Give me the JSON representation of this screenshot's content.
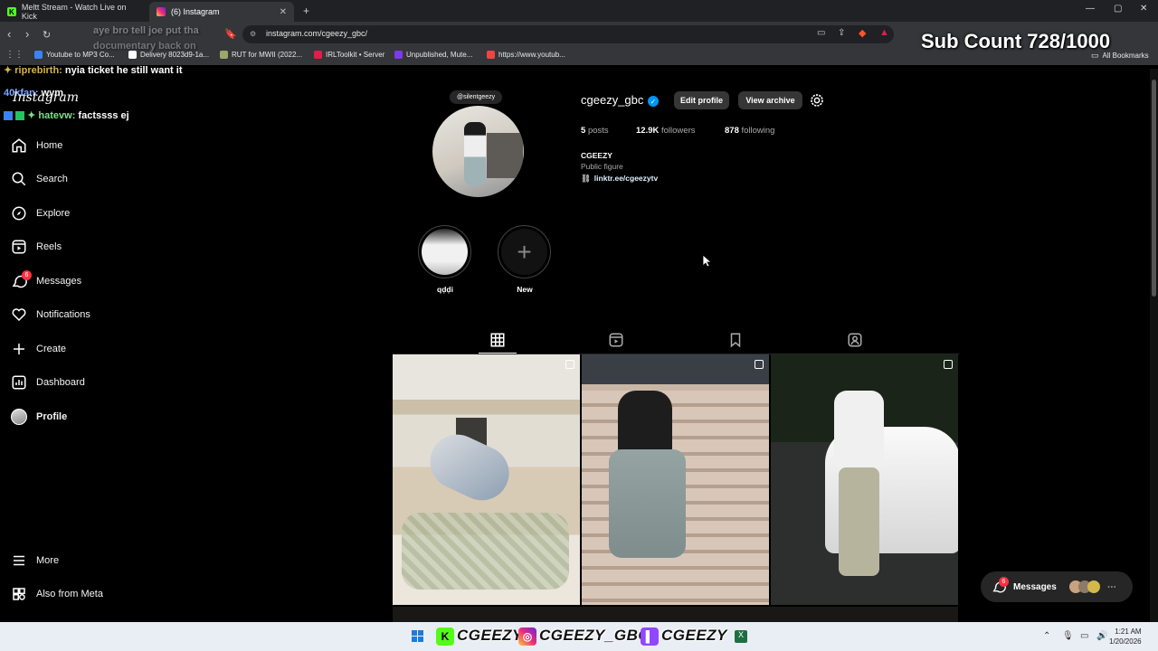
{
  "tabs": [
    {
      "title": "Meltt Stream - Watch Live on Kick",
      "icon": "kick-icon"
    },
    {
      "title": "(6) Instagram",
      "icon": "instagram-icon"
    }
  ],
  "address": {
    "url": "instagram.com/cgeezy_gbc/"
  },
  "bookmarks": [
    {
      "label": "Youtube to MP3 Co...",
      "color": "#3b82f6"
    },
    {
      "label": "Delivery 8023d9-1a...",
      "color": "#ffffff"
    },
    {
      "label": "RUT for MWII (2022...",
      "color": "#9aa86b"
    },
    {
      "label": "IRLToolkit • Server",
      "color": "#e11d48"
    },
    {
      "label": "Unpublished, Mute...",
      "color": "#7c3aed"
    },
    {
      "label": "https://www.youtub...",
      "color": "#ef4444"
    }
  ],
  "bookmarks_all": "All Bookmarks",
  "overlay": {
    "sub_count": "Sub Count 728/1000",
    "chat": [
      {
        "user": "aye bro tell joe put tha",
        "msg": "",
        "color": "#bbbbbb"
      },
      {
        "user": "documentary back on",
        "msg": "",
        "color": "#bbbbbb"
      },
      {
        "user": "✦ riprebirth:",
        "msg": "nyia ticket he still want it",
        "color": "#d4b34a"
      },
      {
        "user": "40kfan:",
        "msg": "wym",
        "color": "#7aa7ff"
      },
      {
        "user": "✦ hatevw:",
        "msg": "factssss ej",
        "color": "#7ee08a"
      }
    ]
  },
  "sidebar": {
    "logo": "Instagram",
    "items": [
      {
        "label": "Home",
        "icon": "home-icon"
      },
      {
        "label": "Search",
        "icon": "search-icon"
      },
      {
        "label": "Explore",
        "icon": "compass-icon"
      },
      {
        "label": "Reels",
        "icon": "reels-icon"
      },
      {
        "label": "Messages",
        "icon": "messenger-icon",
        "badge": "6"
      },
      {
        "label": "Notifications",
        "icon": "heart-icon"
      },
      {
        "label": "Create",
        "icon": "plus-icon"
      },
      {
        "label": "Dashboard",
        "icon": "chart-icon"
      },
      {
        "label": "Profile",
        "icon": "avatar-icon"
      }
    ],
    "bottom": [
      {
        "label": "More",
        "icon": "menu-icon"
      },
      {
        "label": "Also from Meta",
        "icon": "meta-icon"
      }
    ]
  },
  "profile": {
    "note": "@silentgeezy",
    "username": "cgeezy_gbc",
    "verified": true,
    "edit_label": "Edit profile",
    "archive_label": "View archive",
    "posts_count": "5",
    "posts_label": "posts",
    "followers_count": "12.9K",
    "followers_label": "followers",
    "following_count": "878",
    "following_label": "following",
    "name": "CGEEZY",
    "category": "Public figure",
    "link": "linktr.ee/cgeezytv"
  },
  "highlights": [
    {
      "label": "qḍḍi"
    },
    {
      "label": "New"
    }
  ],
  "messages_pill": {
    "label": "Messages",
    "badge": "6"
  },
  "taskbar": {
    "handles": [
      "CGEEZY",
      "CGEEZY_GBC",
      "CGEEZY"
    ],
    "time": "1:21 AM",
    "date": "1/20/2026"
  }
}
